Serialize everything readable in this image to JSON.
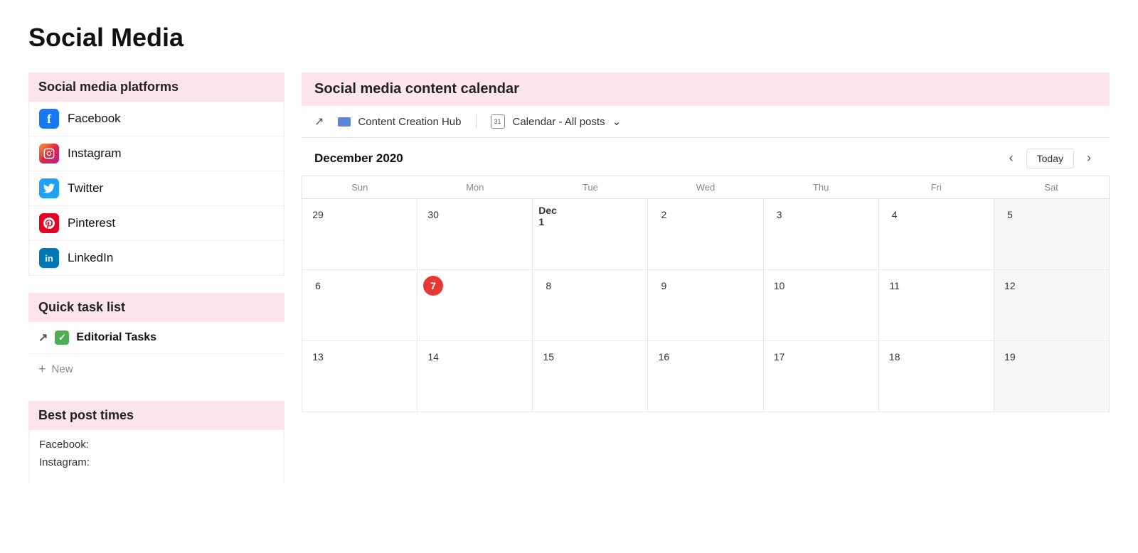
{
  "page": {
    "title": "Social Media"
  },
  "sidebar": {
    "platforms_header": "Social media platforms",
    "platforms": [
      {
        "name": "Facebook",
        "icon_type": "facebook",
        "icon_label": "f"
      },
      {
        "name": "Instagram",
        "icon_type": "instagram",
        "icon_label": "📷"
      },
      {
        "name": "Twitter",
        "icon_type": "twitter",
        "icon_label": "🐦"
      },
      {
        "name": "Pinterest",
        "icon_type": "pinterest",
        "icon_label": "P"
      },
      {
        "name": "LinkedIn",
        "icon_type": "linkedin",
        "icon_label": "in"
      }
    ],
    "quick_task_header": "Quick task list",
    "tasks": [
      {
        "label": "Editorial Tasks",
        "checked": true
      }
    ],
    "new_label": "New",
    "best_post_header": "Best post times",
    "best_posts": [
      {
        "label": "Facebook:"
      },
      {
        "label": "Instagram:"
      }
    ]
  },
  "calendar": {
    "header": "Social media content calendar",
    "link_icon": "↗",
    "hub_label": "Content Creation Hub",
    "calendar_view_label": "Calendar - All posts",
    "month_label": "December 2020",
    "today_label": "Today",
    "today_date": 7,
    "weekdays": [
      "Sun",
      "Mon",
      "Tue",
      "Wed",
      "Thu",
      "Fri",
      "Sat"
    ],
    "weeks": [
      [
        {
          "num": "29",
          "other": true
        },
        {
          "num": "30",
          "other": true
        },
        {
          "num": "Dec 1",
          "bold": true
        },
        {
          "num": "2"
        },
        {
          "num": "3"
        },
        {
          "num": "4"
        },
        {
          "num": "5",
          "weekend": true
        }
      ],
      [
        {
          "num": "6",
          "weekend": false
        },
        {
          "num": "7",
          "today": true
        },
        {
          "num": "8"
        },
        {
          "num": "9"
        },
        {
          "num": "10"
        },
        {
          "num": "11"
        },
        {
          "num": "12",
          "weekend": true
        }
      ],
      [
        {
          "num": "13"
        },
        {
          "num": "14"
        },
        {
          "num": "15"
        },
        {
          "num": "16"
        },
        {
          "num": "17"
        },
        {
          "num": "18"
        },
        {
          "num": "19",
          "weekend": true
        }
      ]
    ]
  }
}
